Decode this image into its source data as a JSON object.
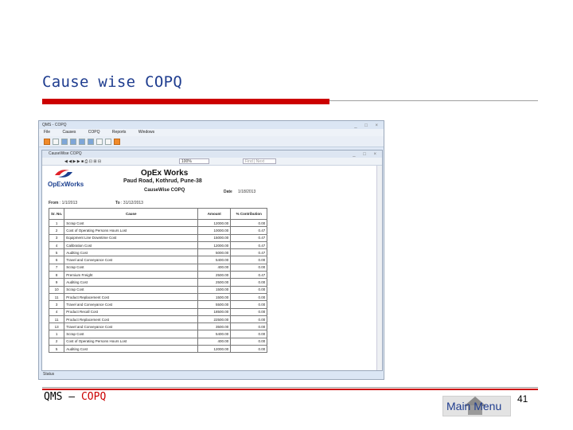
{
  "slide": {
    "title": "Cause wise COPQ",
    "footer_left": "QMS – ",
    "footer_accent": "COPQ",
    "main_menu_label": "Main Menu",
    "page_number": "41"
  },
  "app": {
    "window_title": "QMS - COPQ",
    "menu": [
      "File",
      "Causes",
      "COPQ",
      "Reports",
      "Windows"
    ],
    "inner_title": "CauseWise COPQ",
    "zoom": "100%",
    "find_label": "Find | Next",
    "status": "Status",
    "report": {
      "logo_text": "OpExWorks",
      "company": "OpEx Works",
      "address": "Paud Road, Kothrud, Pune-38",
      "title": "CauseWise COPQ",
      "date_label": "Date",
      "date_value": "1/18/2013",
      "from_label": "From",
      "from_value": "1/1/2013",
      "to_label": "To",
      "to_value": "31/12/2013",
      "columns": [
        "Sr. No.",
        "Cause",
        "Amount",
        "% Contribution"
      ],
      "rows": [
        [
          "1",
          "Scrap Cost",
          "12000.00",
          "0.00"
        ],
        [
          "2",
          "Cost of Operating Persons Hours Lost",
          "10000.00",
          "0.47"
        ],
        [
          "3",
          "Equipment Line Downtime Cost",
          "15000.00",
          "0.47"
        ],
        [
          "4",
          "Calibration Cost",
          "12000.00",
          "0.47"
        ],
        [
          "5",
          "Auditing Cost",
          "5000.00",
          "0.47"
        ],
        [
          "6",
          "Travel and Conveyance Cost",
          "5400.00",
          "0.00"
        ],
        [
          "7",
          "Scrap Cost",
          "400.00",
          "0.00"
        ],
        [
          "8",
          "Premium Freight",
          "2500.00",
          "0.47"
        ],
        [
          "9",
          "Auditing Cost",
          "2500.00",
          "0.00"
        ],
        [
          "10",
          "Scrap Cost",
          "1500.00",
          "0.00"
        ],
        [
          "11",
          "Product Replacement Cost",
          "1500.00",
          "0.00"
        ],
        [
          "3",
          "Travel and Conveyance Cost",
          "5500.00",
          "0.00"
        ],
        [
          "4",
          "Product Recall Cost",
          "18500.00",
          "0.00"
        ],
        [
          "11",
          "Product Replacement Cost",
          "22500.00",
          "0.00"
        ],
        [
          "13",
          "Travel and Conveyance Cost",
          "3500.00",
          "0.00"
        ],
        [
          "1",
          "Scrap Cost",
          "5400.00",
          "0.00"
        ],
        [
          "2",
          "Cost of Operating Persons Hours Lost",
          "400.00",
          "0.00"
        ],
        [
          "5",
          "Auditing Cost",
          "12000.00",
          "0.00"
        ]
      ]
    }
  },
  "colors": {
    "title_blue": "#1f3d8f",
    "accent_red": "#cc0000"
  }
}
